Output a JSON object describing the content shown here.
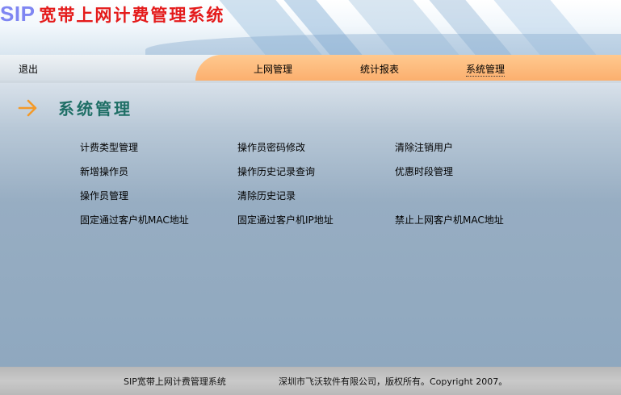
{
  "banner": {
    "brand_sip": "SIP",
    "brand_title": "宽带上网计费管理系统"
  },
  "nav": {
    "logout": "退出",
    "items": [
      "上网管理",
      "统计报表",
      "系统管理"
    ],
    "active_index": 2
  },
  "section": {
    "icon": "arrow-right-icon",
    "title": "系统管理"
  },
  "menu": {
    "col1": [
      "计费类型管理",
      "新增操作员",
      "操作员管理",
      "固定通过客户机MAC地址"
    ],
    "col2": [
      "操作员密码修改",
      "操作历史记录查询",
      "清除历史记录",
      "固定通过客户机IP地址"
    ],
    "col3": [
      "清除注销用户",
      "优惠时段管理",
      "禁止上网客户机MAC地址"
    ]
  },
  "footer": {
    "system_name": "SIP宽带上网计费管理系统",
    "copyright": "深圳市飞沃软件有限公司，版权所有。Copyright 2007。"
  },
  "colors": {
    "brand_sip": "#7f86f2",
    "brand_title": "#e41b1b",
    "nav_orange": "#fbaf6e",
    "section_title": "#1f6f66",
    "arrow": "#f39a2a",
    "main_bg": "#8fa8bf"
  }
}
